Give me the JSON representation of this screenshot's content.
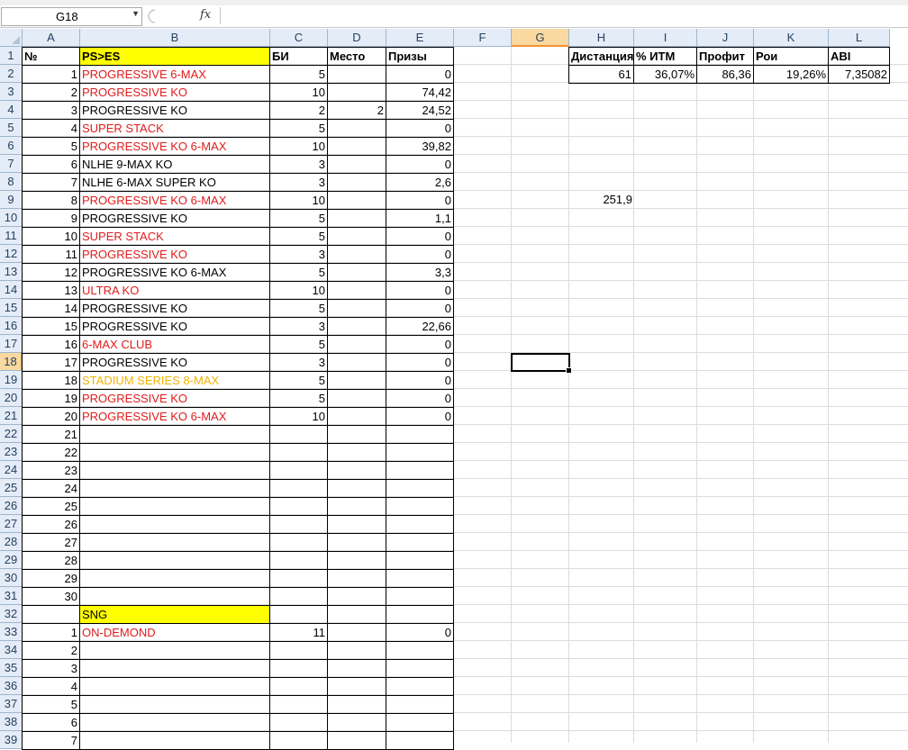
{
  "namebox": {
    "value": "G18"
  },
  "fx_label": "fx",
  "columns": [
    "A",
    "B",
    "C",
    "D",
    "E",
    "F",
    "G",
    "H",
    "I",
    "J",
    "K",
    "L"
  ],
  "rows": [
    "1",
    "2",
    "3",
    "4",
    "5",
    "6",
    "7",
    "8",
    "9",
    "10",
    "11",
    "12",
    "13",
    "14",
    "15",
    "16",
    "17",
    "18",
    "19",
    "20",
    "21",
    "22",
    "23",
    "24",
    "25",
    "26",
    "27",
    "28",
    "29",
    "30",
    "31",
    "32",
    "33",
    "34",
    "35",
    "36",
    "37",
    "38",
    "39"
  ],
  "headers": {
    "no": "№",
    "name": "PS>ES",
    "bi": "БИ",
    "place": "Место",
    "prizes": "Призы"
  },
  "tournaments": [
    {
      "n": "1",
      "name": "PROGRESSIVE 6-MAX",
      "color": "red",
      "bi": "5",
      "place": "",
      "prize": "0"
    },
    {
      "n": "2",
      "name": "PROGRESSIVE KO",
      "color": "red",
      "bi": "10",
      "place": "",
      "prize": "74,42"
    },
    {
      "n": "3",
      "name": "PROGRESSIVE KO",
      "color": "black",
      "bi": "2",
      "place": "2",
      "prize": "24,52"
    },
    {
      "n": "4",
      "name": "SUPER STACK",
      "color": "red",
      "bi": "5",
      "place": "",
      "prize": "0"
    },
    {
      "n": "5",
      "name": "PROGRESSIVE KO 6-MAX",
      "color": "red",
      "bi": "10",
      "place": "",
      "prize": "39,82"
    },
    {
      "n": "6",
      "name": "NLHE 9-MAX KO",
      "color": "black",
      "bi": "3",
      "place": "",
      "prize": "0"
    },
    {
      "n": "7",
      "name": "NLHE 6-MAX SUPER  KO",
      "color": "black",
      "bi": "3",
      "place": "",
      "prize": "2,6"
    },
    {
      "n": "8",
      "name": "PROGRESSIVE KO 6-MAX",
      "color": "red",
      "bi": "10",
      "place": "",
      "prize": "0"
    },
    {
      "n": "9",
      "name": "PROGRESSIVE KO",
      "color": "black",
      "bi": "5",
      "place": "",
      "prize": "1,1"
    },
    {
      "n": "10",
      "name": "SUPER STACK",
      "color": "red",
      "bi": "5",
      "place": "",
      "prize": "0"
    },
    {
      "n": "11",
      "name": "PROGRESSIVE KO",
      "color": "red",
      "bi": "3",
      "place": "",
      "prize": "0"
    },
    {
      "n": "12",
      "name": "PROGRESSIVE KO 6-MAX",
      "color": "black",
      "bi": "5",
      "place": "",
      "prize": "3,3"
    },
    {
      "n": "13",
      "name": "ULTRA KO",
      "color": "red",
      "bi": "10",
      "place": "",
      "prize": "0"
    },
    {
      "n": "14",
      "name": "PROGRESSIVE KO",
      "color": "black",
      "bi": "5",
      "place": "",
      "prize": "0"
    },
    {
      "n": "15",
      "name": "PROGRESSIVE KO",
      "color": "black",
      "bi": "3",
      "place": "",
      "prize": "22,66"
    },
    {
      "n": "16",
      "name": "6-MAX CLUB",
      "color": "red",
      "bi": "5",
      "place": "",
      "prize": "0"
    },
    {
      "n": "17",
      "name": "PROGRESSIVE KO",
      "color": "black",
      "bi": "3",
      "place": "",
      "prize": "0"
    },
    {
      "n": "18",
      "name": "STADIUM SERIES 8-MAX",
      "color": "gold",
      "bi": "5",
      "place": "",
      "prize": "0"
    },
    {
      "n": "19",
      "name": "PROGRESSIVE KO",
      "color": "red",
      "bi": "5",
      "place": "",
      "prize": "0"
    },
    {
      "n": "20",
      "name": "PROGRESSIVE KO 6-MAX",
      "color": "red",
      "bi": "10",
      "place": "",
      "prize": "0"
    }
  ],
  "empty_numbers": [
    "21",
    "22",
    "23",
    "24",
    "25",
    "26",
    "27",
    "28",
    "29",
    "30"
  ],
  "sng": {
    "label": "SNG",
    "rows": [
      {
        "n": "1",
        "name": "ON-DEMOND",
        "color": "red",
        "bi": "11",
        "prize": "0"
      }
    ],
    "empty_numbers": [
      "2",
      "3",
      "4",
      "5",
      "6",
      "7"
    ]
  },
  "stats": {
    "headers": [
      "Дистанция",
      "% ИТМ",
      "Профит",
      "Рои",
      "ABI"
    ],
    "values": [
      "61",
      "36,07%",
      "86,36",
      "19,26%",
      "7,35082"
    ]
  },
  "h9_value": "251,9",
  "colors": {
    "red": "#e01c1c",
    "gold": "#f0b400",
    "yellow": "#ffff00",
    "header_bg": "#e4ecf7",
    "selected_header": "#f9d99f"
  }
}
